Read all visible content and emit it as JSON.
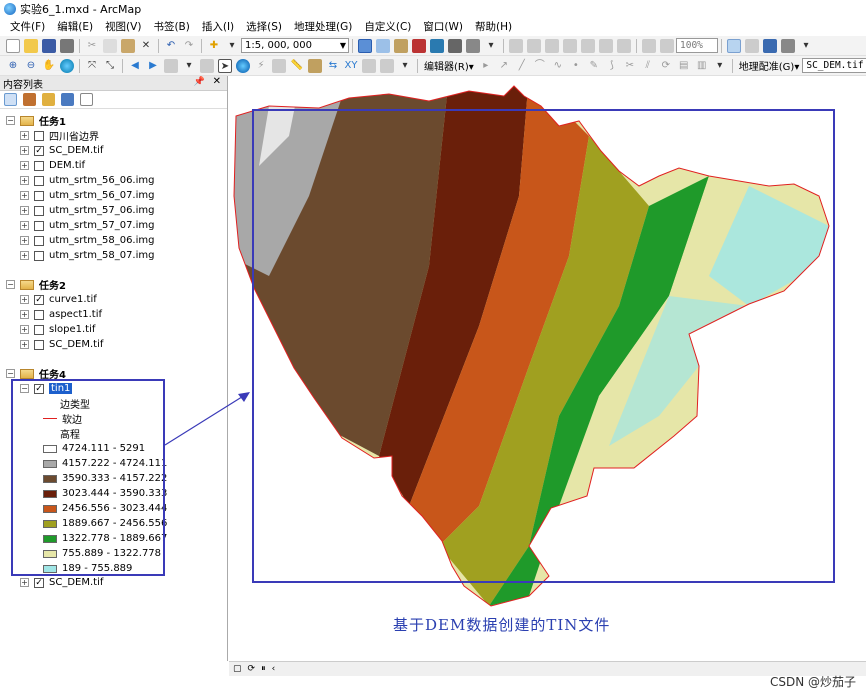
{
  "window": {
    "title": "实验6_1.mxd - ArcMap"
  },
  "menu": [
    "文件(F)",
    "编辑(E)",
    "视图(V)",
    "书签(B)",
    "插入(I)",
    "选择(S)",
    "地理处理(G)",
    "自定义(C)",
    "窗口(W)",
    "帮助(H)"
  ],
  "toolbar": {
    "scale": "1:5, 000, 000",
    "zoom": "100%",
    "editor_label": "编辑器(R)▾",
    "georef_label": "地理配准(G)▾",
    "georef_layer": "SC_DEM.tif"
  },
  "toc": {
    "title": "内容列表",
    "pin": "📌",
    "close": "✕",
    "groups": [
      {
        "name": "任务1",
        "layers": [
          {
            "name": "四川省边界",
            "checked": false
          },
          {
            "name": "SC_DEM.tif",
            "checked": true
          },
          {
            "name": "DEM.tif",
            "checked": false
          },
          {
            "name": "utm_srtm_56_06.img",
            "checked": false
          },
          {
            "name": "utm_srtm_56_07.img",
            "checked": false
          },
          {
            "name": "utm_srtm_57_06.img",
            "checked": false
          },
          {
            "name": "utm_srtm_57_07.img",
            "checked": false
          },
          {
            "name": "utm_srtm_58_06.img",
            "checked": false
          },
          {
            "name": "utm_srtm_58_07.img",
            "checked": false
          }
        ]
      },
      {
        "name": "任务2",
        "layers": [
          {
            "name": "curve1.tif",
            "checked": true
          },
          {
            "name": "aspect1.tif",
            "checked": false
          },
          {
            "name": "slope1.tif",
            "checked": false
          },
          {
            "name": "SC_DEM.tif",
            "checked": false
          }
        ]
      },
      {
        "name": "任务4",
        "layers": [
          {
            "name": "tin1",
            "checked": true,
            "selected": true
          },
          {
            "name": "SC_DEM.tif",
            "checked": true
          }
        ]
      }
    ],
    "tin_legend": {
      "edge_type_heading": "边类型",
      "soft_edge_label": "软边",
      "elevation_heading": "高程",
      "classes": [
        {
          "label": "4724.111 - 5291",
          "color": "#ffffff"
        },
        {
          "label": "4157.222 - 4724.111",
          "color": "#a8a8a8"
        },
        {
          "label": "3590.333 - 4157.222",
          "color": "#6b4a2e"
        },
        {
          "label": "3023.444 - 3590.333",
          "color": "#6a1f0a"
        },
        {
          "label": "2456.556 - 3023.444",
          "color": "#c8561a"
        },
        {
          "label": "1889.667 - 2456.556",
          "color": "#a0a020"
        },
        {
          "label": "1322.778 - 1889.667",
          "color": "#1f9a2a"
        },
        {
          "label": "755.889 - 1322.778",
          "color": "#e6e6a8"
        },
        {
          "label": "189 - 755.889",
          "color": "#a0e6e6"
        }
      ]
    }
  },
  "map": {
    "annotation": "基于DEM数据创建的TIN文件"
  },
  "status": {
    "items": [
      "▢",
      "⟳",
      "⏸",
      "‹"
    ]
  },
  "watermark": "CSDN @炒茄子",
  "colors": {
    "accent": "#3a3ab8",
    "soft_edge": "#e02020"
  }
}
